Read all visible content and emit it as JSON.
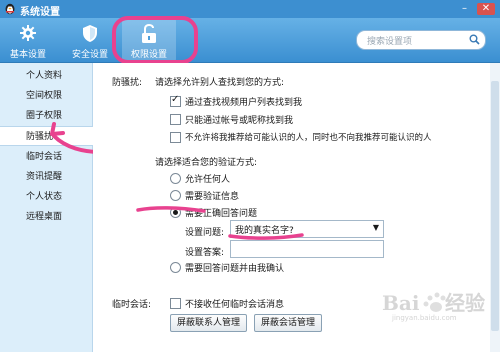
{
  "window": {
    "title": "系统设置"
  },
  "toolbar": {
    "items": [
      {
        "label": "基本设置",
        "icon": "gear-icon"
      },
      {
        "label": "安全设置",
        "icon": "shield-icon"
      },
      {
        "label": "权限设置",
        "icon": "lock-icon"
      }
    ],
    "active": "权限设置",
    "search_placeholder": "搜索设置项"
  },
  "sidebar": {
    "items": [
      {
        "label": "个人资料"
      },
      {
        "label": "空间权限"
      },
      {
        "label": "圈子权限"
      },
      {
        "label": "防骚扰"
      },
      {
        "label": "临时会话"
      },
      {
        "label": "资讯提醒"
      },
      {
        "label": "个人状态"
      },
      {
        "label": "远程桌面"
      }
    ],
    "active": "防骚扰"
  },
  "main": {
    "section_label": "防骚扰:",
    "find_prompt": "请选择允许别人查找到您的方式:",
    "find_options": [
      {
        "label": "通过查找视频用户列表找到我",
        "checked": true
      },
      {
        "label": "只能通过帐号或昵称找到我",
        "checked": false
      },
      {
        "label": "不允许将我推荐给可能认识的人，同时也不向我推荐可能认识的人",
        "checked": false
      }
    ],
    "verify_prompt": "请选择适合您的验证方式:",
    "verify_options": [
      {
        "label": "允许任何人",
        "selected": false
      },
      {
        "label": "需要验证信息",
        "selected": false
      },
      {
        "label": "需要正确回答问题",
        "selected": true
      },
      {
        "label": "需要回答问题并由我确认",
        "selected": false
      }
    ],
    "question_label": "设置问题:",
    "question_value": "我的真实名字?",
    "answer_label": "设置答案:",
    "answer_value": "",
    "temp_session_label": "临时会话:",
    "temp_session_option": "不接收任何临时会话消息",
    "temp_session_checked": false,
    "buttons": {
      "block_contacts": "屏蔽联系人管理",
      "block_sessions": "屏蔽会话管理"
    }
  },
  "annotation_color": "#e8428f",
  "accent_color": "#3d8fd0"
}
